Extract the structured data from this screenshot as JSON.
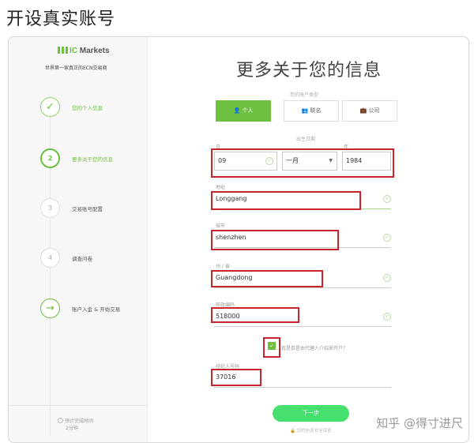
{
  "page_title": "开设真实账号",
  "sidebar": {
    "logo_prefix": "IC",
    "logo_suffix": " Markets",
    "tagline": "世界第一家真正的ECN交易商",
    "steps": [
      {
        "number": "1",
        "label": "您的个人信息",
        "state": "done",
        "icon": "✓"
      },
      {
        "number": "2",
        "label": "更多关于您的信息",
        "state": "active",
        "icon": "2"
      },
      {
        "number": "3",
        "label": "交易账号配置",
        "state": "pending",
        "icon": "3"
      },
      {
        "number": "4",
        "label": "调查问卷",
        "state": "pending",
        "icon": "4"
      },
      {
        "number": "5",
        "label": "账户入金 & 开始交易",
        "state": "next",
        "icon": "→"
      }
    ],
    "footer_time": "预计完成时间",
    "footer_duration": "2分钟"
  },
  "main": {
    "heading": "更多关于您的信息",
    "account_type_label": "您的账户类型",
    "account_types": [
      {
        "label": "个人",
        "icon": "person-icon",
        "active": true
      },
      {
        "label": "联名",
        "icon": "group-icon",
        "active": false
      },
      {
        "label": "公司",
        "icon": "briefcase-icon",
        "active": false
      }
    ],
    "dob_label": "出生日期",
    "day_label": "日",
    "day_value": "09",
    "month_value": "一月",
    "year_label": "年",
    "year_value": "1984",
    "address_label": "地址",
    "address_value": "Longgang",
    "city_label": "城市",
    "city_value": "shenzhen",
    "province_label": "州 / 省",
    "province_value": "Guangdong",
    "postal_label": "邮政编码",
    "postal_value": "518000",
    "checkbox_text": "我是否是由代理人介绍来开户？",
    "agent_label": "经纪人号码",
    "agent_value": "37016",
    "next_button": "下一步",
    "secure_text": "您的信息安全保密",
    "check_glyph": "✓"
  },
  "watermark": "知乎 @得寸进尺",
  "colors": {
    "accent_green": "#6cbf3f",
    "button_green": "#45e06e",
    "highlight_red": "#c8242b"
  }
}
